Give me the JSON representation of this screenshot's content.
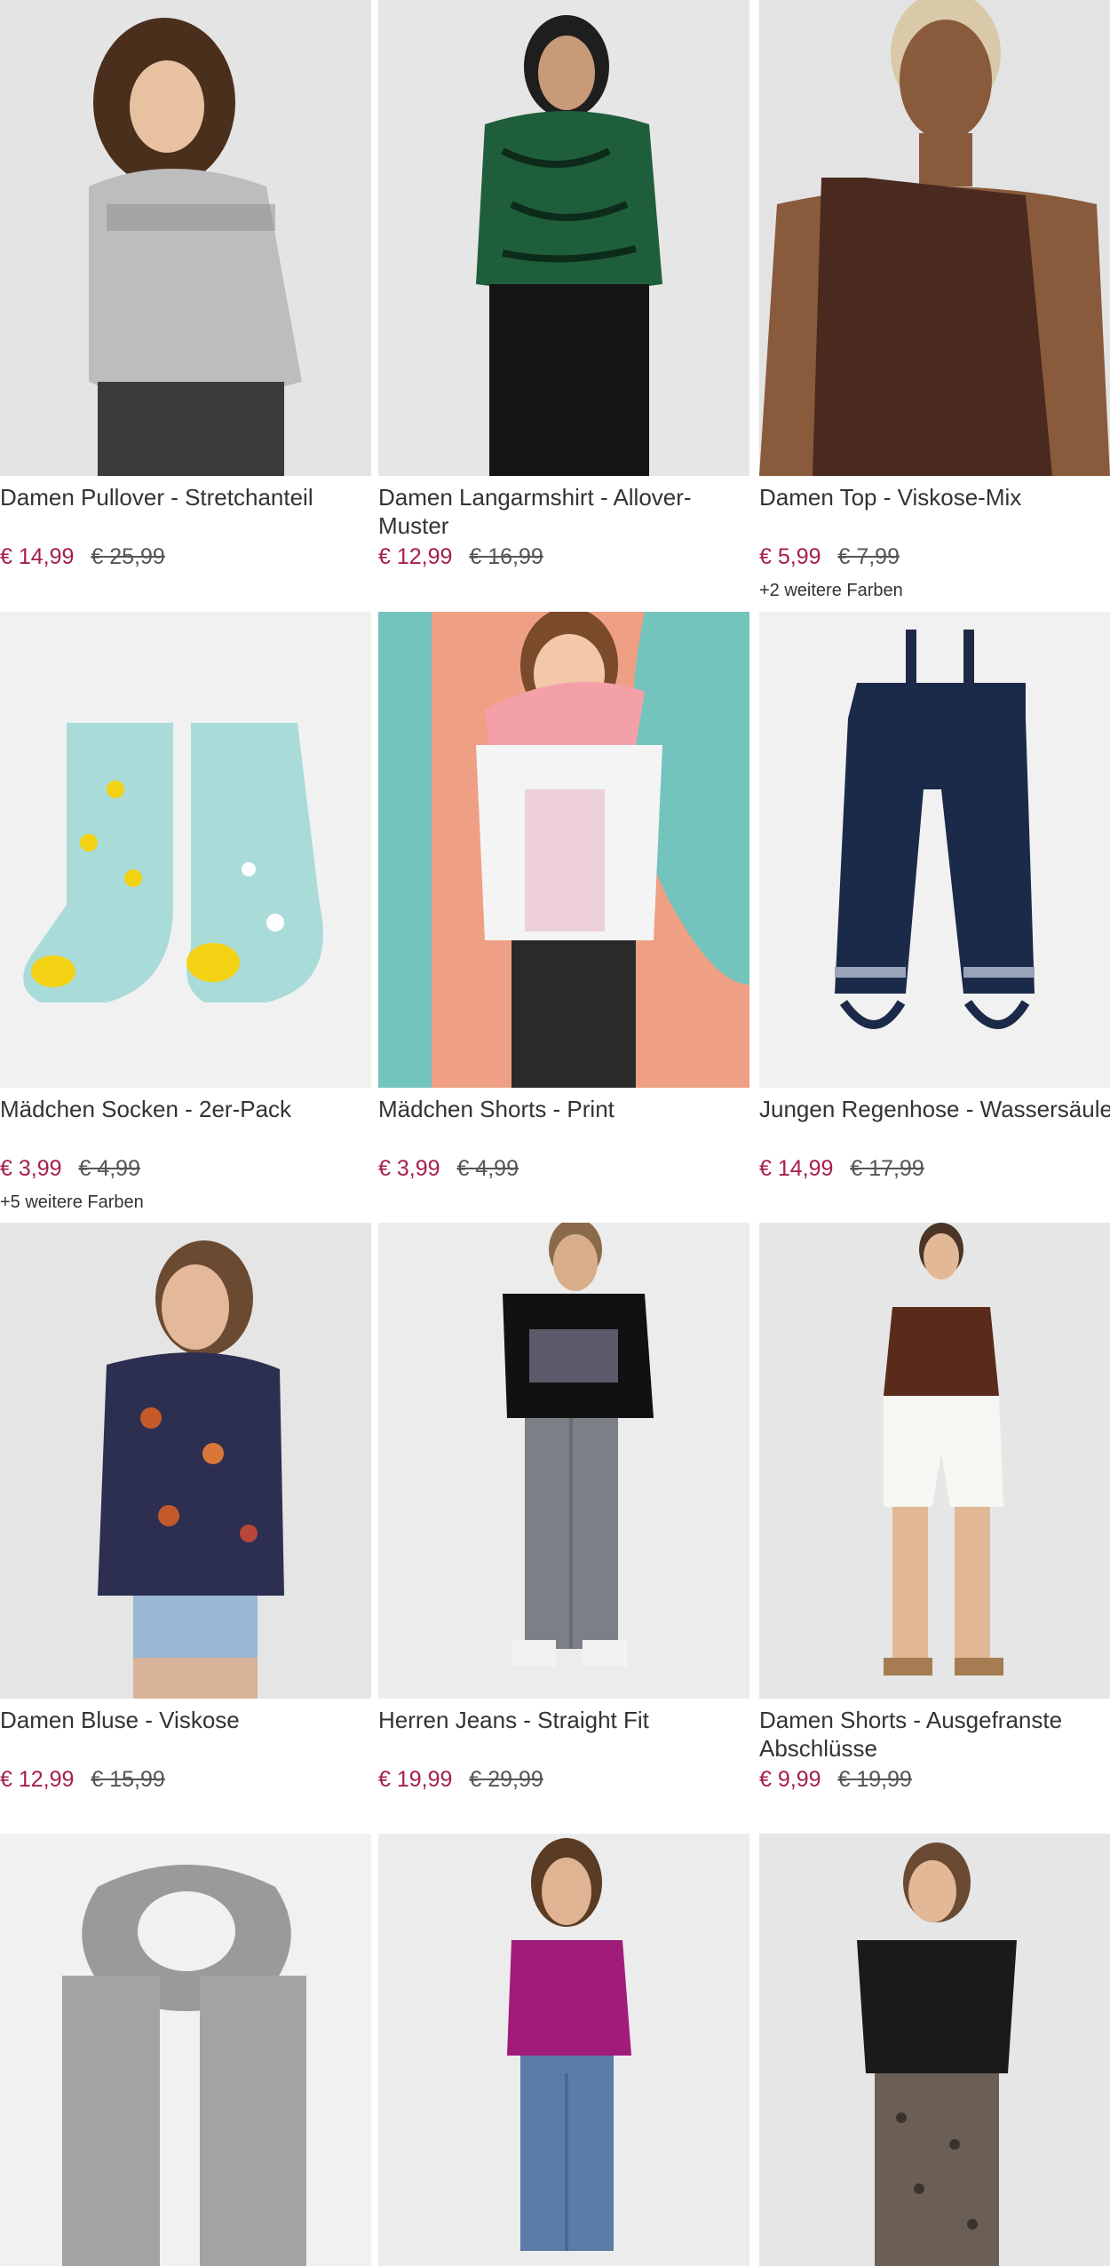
{
  "products": [
    {
      "name": "Damen Pullover - Stretchanteil",
      "price": "€ 14,99",
      "old_price": "€ 25,99",
      "colors": "",
      "image": "woman-grey-sweater"
    },
    {
      "name": "Damen Langarmshirt - Allover-Muster",
      "price": "€ 12,99",
      "old_price": "€ 16,99",
      "colors": "",
      "image": "woman-green-pattern-shirt"
    },
    {
      "name": "Damen Top - Viskose-Mix",
      "price": "€ 5,99",
      "old_price": "€ 7,99",
      "colors": "+2 weitere Farben",
      "image": "woman-brown-one-shoulder-top"
    },
    {
      "name": "Mädchen Socken - 2er-Pack",
      "price": "€ 3,99",
      "old_price": "€ 4,99",
      "colors": "+5 weitere Farben",
      "image": "duck-print-socks"
    },
    {
      "name": "Mädchen Shorts - Print",
      "price": "€ 3,99",
      "old_price": "€ 4,99",
      "colors": "",
      "image": "girl-watermelon-bag"
    },
    {
      "name": "Jungen Regenhose - Wassersäule",
      "price": "€ 14,99",
      "old_price": "€ 17,99",
      "colors": "",
      "image": "navy-rain-dungarees"
    },
    {
      "name": "Damen Bluse - Viskose",
      "price": "€ 12,99",
      "old_price": "€ 15,99",
      "colors": "",
      "image": "woman-floral-blouse"
    },
    {
      "name": "Herren Jeans - Straight Fit",
      "price": "€ 19,99",
      "old_price": "€ 29,99",
      "colors": "",
      "image": "man-grey-jeans"
    },
    {
      "name": "Damen Shorts - Ausgefranste Abschlüsse",
      "price": "€ 9,99",
      "old_price": "€ 19,99",
      "colors": "",
      "image": "woman-white-shorts"
    },
    {
      "name": "",
      "price": "",
      "old_price": "",
      "colors": "",
      "image": "grey-knit-scarf"
    },
    {
      "name": "",
      "price": "",
      "old_price": "",
      "colors": "",
      "image": "woman-magenta-top-jeans"
    },
    {
      "name": "",
      "price": "",
      "old_price": "",
      "colors": "",
      "image": "woman-black-top-patterned-pants"
    }
  ],
  "colors": {
    "sale_price": "#a61e4d",
    "text": "#333333",
    "image_bg": "#efefef"
  }
}
